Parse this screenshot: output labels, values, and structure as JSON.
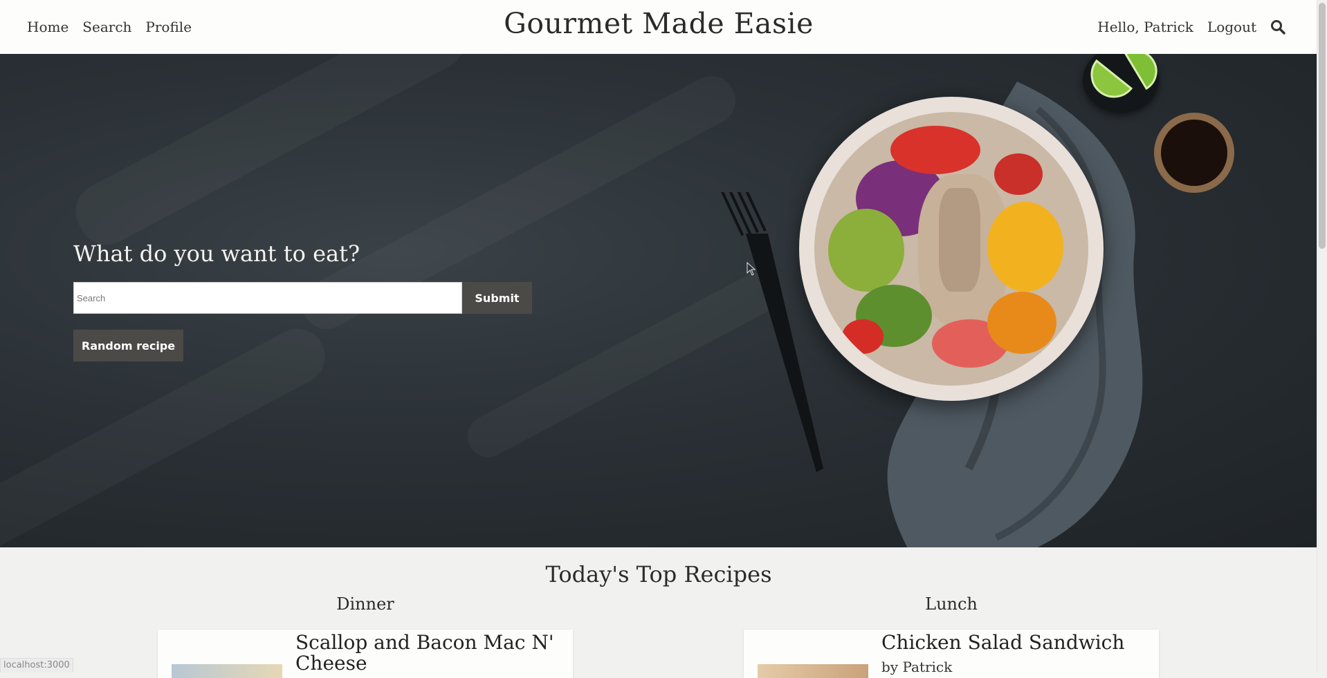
{
  "nav": {
    "home": "Home",
    "search": "Search",
    "profile": "Profile",
    "brand": "Gourmet Made Easie",
    "greeting": "Hello, Patrick",
    "logout": "Logout",
    "search_icon": "search-icon"
  },
  "hero": {
    "title": "What do you want to eat?",
    "search_placeholder": "Search",
    "submit_label": "Submit",
    "random_label": "Random recipe"
  },
  "top": {
    "title": "Today's Top Recipes",
    "columns": [
      {
        "heading": "Dinner",
        "recipe_title": "Scallop and Bacon Mac N' Cheese",
        "author": ""
      },
      {
        "heading": "Lunch",
        "recipe_title": "Chicken Salad Sandwich",
        "author": "by Patrick"
      }
    ]
  },
  "status_url": "localhost:3000",
  "colors": {
    "button_bg": "#4b4a47",
    "page_bg": "#f1f2ef",
    "hero_bg": "#2a3035"
  }
}
